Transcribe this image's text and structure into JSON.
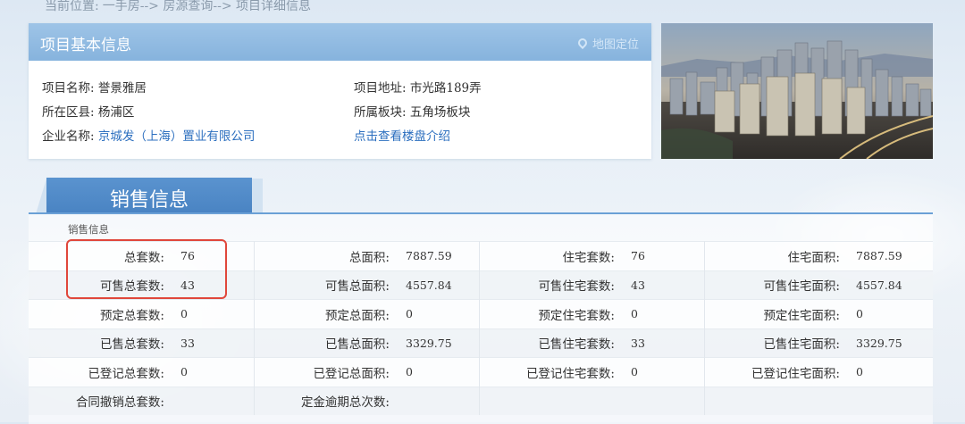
{
  "breadcrumb": {
    "prefix": "当前位置:",
    "path": "一手房--> 房源查询--> 项目详细信息"
  },
  "project_info": {
    "title": "项目基本信息",
    "map_link": "地图定位",
    "name_label": "项目名称:",
    "name_value": "誉景雅居",
    "district_label": "所在区县:",
    "district_value": "杨浦区",
    "company_label": "企业名称:",
    "company_value": "京城发（上海）置业有限公司",
    "address_label": "项目地址:",
    "address_value": "市光路189弄",
    "plate_label": "所属板块:",
    "plate_value": "五角场板块",
    "intro_link": "点击查看楼盘介绍"
  },
  "sales": {
    "tab_label": "销售信息",
    "subtitle": "销售信息",
    "rows": [
      [
        "总套数:",
        "76",
        "总面积:",
        "7887.59",
        "住宅套数:",
        "76",
        "住宅面积:",
        "7887.59"
      ],
      [
        "可售总套数:",
        "43",
        "可售总面积:",
        "4557.84",
        "可售住宅套数:",
        "43",
        "可售住宅面积:",
        "4557.84"
      ],
      [
        "预定总套数:",
        "0",
        "预定总面积:",
        "0",
        "预定住宅套数:",
        "0",
        "预定住宅面积:",
        "0"
      ],
      [
        "已售总套数:",
        "33",
        "已售总面积:",
        "3329.75",
        "已售住宅套数:",
        "33",
        "已售住宅面积:",
        "3329.75"
      ],
      [
        "已登记总套数:",
        "0",
        "已登记总面积:",
        "0",
        "已登记住宅套数:",
        "0",
        "已登记住宅面积:",
        "0"
      ],
      [
        "合同撤销总套数:",
        "",
        "定金逾期总次数:",
        "",
        "",
        "",
        "",
        ""
      ]
    ]
  },
  "colors": {
    "header_blue": "#86b3dd",
    "tab_blue": "#4a84c3",
    "link_blue": "#2c6fbf",
    "highlight_red": "#e0473b"
  }
}
